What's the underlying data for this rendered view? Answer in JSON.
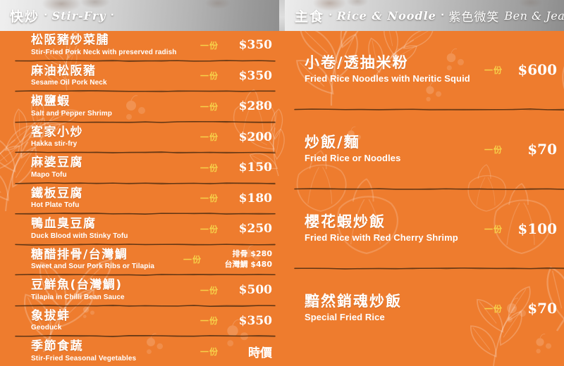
{
  "board": {
    "background_color": "#ee7c2e",
    "unit_color": "#f6d24a",
    "text_color": "#ffffff",
    "divider_color": "#5b3313"
  },
  "header": {
    "left": {
      "cn": "快炒",
      "dot_left": "▪",
      "en": "Stir-Fry",
      "dot_right": "▪"
    },
    "right": {
      "cn": "主食",
      "dot_left": "▪",
      "en": "Rice & Noodle",
      "dot_right": "▪",
      "signature_cn": "紫色微笑",
      "signature_en": "Ben & Jean"
    }
  },
  "left_column": {
    "items": [
      {
        "name_cn": "松阪豬炒菜脯",
        "name_en": "Stir-Fried Pork Neck with preserved radish",
        "unit": "一份",
        "price": "$350"
      },
      {
        "name_cn": "麻油松阪豬",
        "name_en": "Sesame Oil Pork Neck",
        "unit": "一份",
        "price": "$350"
      },
      {
        "name_cn": "椒鹽蝦",
        "name_en": "Salt and Pepper Shrimp",
        "unit": "一份",
        "price": "$280"
      },
      {
        "name_cn": "客家小炒",
        "name_en": "Hakka stir-fry",
        "unit": "一份",
        "price": "$200"
      },
      {
        "name_cn": "麻婆豆腐",
        "name_en": "Mapo Tofu",
        "unit": "一份",
        "price": "$150"
      },
      {
        "name_cn": "鐵板豆腐",
        "name_en": "Hot Plate Tofu",
        "unit": "一份",
        "price": "$180"
      },
      {
        "name_cn": "鴨血臭豆腐",
        "name_en": "Duck Blood with Stinky Tofu",
        "unit": "一份",
        "price": "$250"
      },
      {
        "name_cn": "糖醋排骨/台灣鯛",
        "name_en": "Sweet and Sour Pork Ribs or Tilapia",
        "unit": "一份",
        "price_lines": [
          "排骨 $280",
          "台灣鯛 $480"
        ]
      },
      {
        "name_cn": "豆鮮魚(台灣鯛)",
        "name_en": "Tilapia in Chilli Bean Sauce",
        "unit": "一份",
        "price": "$500"
      },
      {
        "name_cn": "象拔蚌",
        "name_en": "Geoduck",
        "unit": "一份",
        "price": "$350"
      },
      {
        "name_cn": "季節食蔬",
        "name_en": "Stir-Fried Seasonal Vegetables",
        "unit": "一份",
        "price": "時價"
      }
    ]
  },
  "right_column": {
    "items": [
      {
        "name_cn": "小卷/透抽米粉",
        "name_en": "Fried Rice Noodles with Neritic Squid",
        "unit": "一份",
        "price": "$600"
      },
      {
        "name_cn": "炒飯/麵",
        "name_en": "Fried Rice or Noodles",
        "unit": "一份",
        "price": "$70"
      },
      {
        "name_cn": "櫻花蝦炒飯",
        "name_en": "Fried Rice with Red Cherry Shrimp",
        "unit": "一份",
        "price": "$100"
      },
      {
        "name_cn": "黯然銷魂炒飯",
        "name_en": "Special Fried Rice",
        "unit": "一份",
        "price": "$70"
      }
    ]
  }
}
